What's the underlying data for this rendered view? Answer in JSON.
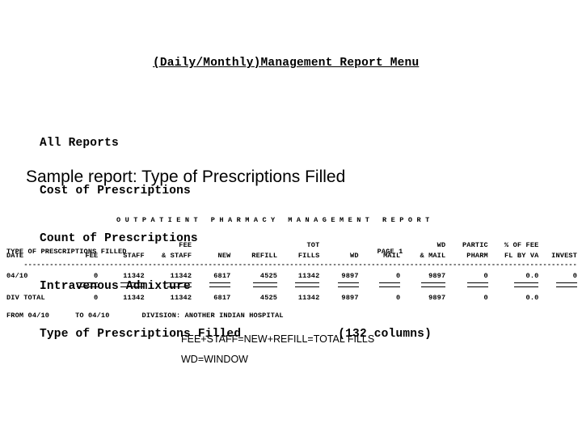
{
  "menu": {
    "title": "(Daily/Monthly)Management Report Menu",
    "items": [
      "All Reports",
      "Cost of Prescriptions",
      "Count of Prescriptions",
      "Intravenous Admixture",
      "Type of Prescriptions Filled"
    ],
    "columns_note": "(132 columns)"
  },
  "sample": {
    "heading": "Sample report: Type of Prescriptions Filled"
  },
  "report": {
    "banner": "O U T P A T I E N T   P H A R M A C Y   M A N A G E M E N T   R E P O R T",
    "subtitle": "TYPE OF PRESCRIPTIONS FILLED",
    "page": "PAGE 1",
    "from_label": "FROM 04/10",
    "to_label": "TO 04/10",
    "division": "DIVISION: ANOTHER INDIAN HOSPITAL",
    "dashes": "---------------------------------------------------------------------------------------------------------------------------------",
    "headers_top": [
      "",
      "",
      "",
      "FEE",
      "",
      "",
      "TOT",
      "",
      "",
      "WD",
      "PARTIC",
      "% OF FEE",
      ""
    ],
    "headers_bottom": [
      "DATE",
      "FEE",
      "STAFF",
      "& STAFF",
      "NEW",
      "REFILL",
      "FILLS",
      "WD",
      "MAIL",
      "& MAIL",
      "PHARM",
      "FL BY VA",
      "INVEST"
    ],
    "data_row": [
      "04/10",
      "0",
      "11342",
      "11342",
      "6817",
      "4525",
      "11342",
      "9897",
      "0",
      "9897",
      "0",
      "0.0",
      "0"
    ],
    "total_row": [
      "DIV TOTAL",
      "0",
      "11342",
      "11342",
      "6817",
      "4525",
      "11342",
      "9897",
      "0",
      "9897",
      "0",
      "0.0",
      ""
    ]
  },
  "footnotes": {
    "line1": "FEE+STAFF=NEW+REFILL=TOTAL FILLS",
    "line2": "WD=WINDOW"
  },
  "colors": {
    "background": "#ffffff",
    "text": "#000000"
  }
}
